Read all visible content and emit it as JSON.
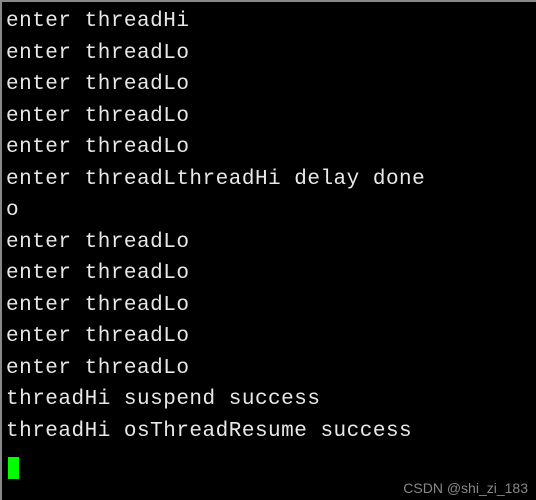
{
  "terminal": {
    "lines": [
      "enter threadHi",
      "enter threadLo",
      "enter threadLo",
      "enter threadLo",
      "enter threadLo",
      "enter threadLthreadHi delay done",
      "o",
      "enter threadLo",
      "enter threadLo",
      "enter threadLo",
      "enter threadLo",
      "enter threadLo",
      "threadHi suspend success",
      "threadHi osThreadResume success"
    ]
  },
  "watermark": "CSDN @shi_zi_183"
}
